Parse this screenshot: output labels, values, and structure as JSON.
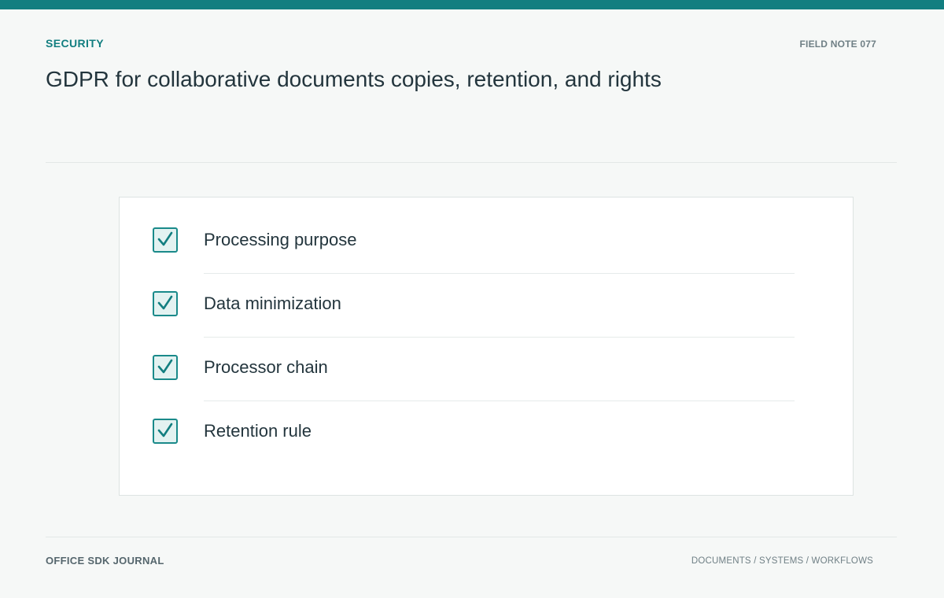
{
  "header": {
    "category": "SECURITY",
    "field_note": "FIELD NOTE 077",
    "title": "GDPR for collaborative documents copies, retention, and rights"
  },
  "checklist": {
    "items": [
      {
        "label": "Processing purpose",
        "checked": true
      },
      {
        "label": "Data minimization",
        "checked": true
      },
      {
        "label": "Processor chain",
        "checked": true
      },
      {
        "label": "Retention rule",
        "checked": true
      }
    ]
  },
  "footer": {
    "publication": "OFFICE SDK JOURNAL",
    "topics": "DOCUMENTS / SYSTEMS / WORKFLOWS"
  },
  "colors": {
    "accent": "#127e80",
    "checkbox_fill": "#e3f2f1",
    "text": "#23353d",
    "background": "#f6f8f7"
  },
  "icons": {
    "checkbox": "check-icon"
  }
}
